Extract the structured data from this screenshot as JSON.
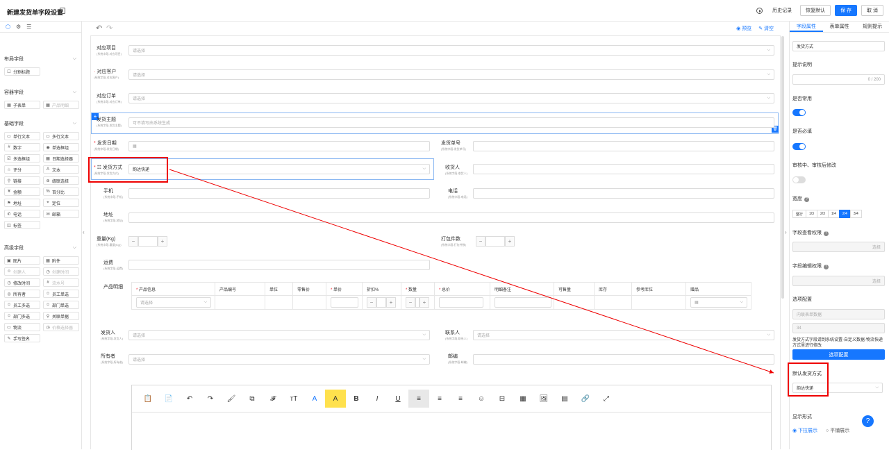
{
  "header": {
    "title": "新建发货单字段设置",
    "history": "历史记录",
    "restore": "恢复默认",
    "save": "保 存",
    "cancel": "取 消"
  },
  "left": {
    "groups": [
      {
        "title": "布局字段",
        "items": [
          {
            "label": "分割标题",
            "icon": "☐",
            "disabled": false
          }
        ]
      },
      {
        "title": "容器字段",
        "items": [
          {
            "label": "子表单",
            "icon": "▦",
            "disabled": false
          },
          {
            "label": "产品明细",
            "icon": "▦",
            "disabled": true
          }
        ]
      },
      {
        "title": "基础字段",
        "items": [
          {
            "label": "单行文本",
            "icon": "▭",
            "disabled": false
          },
          {
            "label": "多行文本",
            "icon": "▭",
            "disabled": false
          },
          {
            "label": "数字",
            "icon": "#",
            "disabled": false
          },
          {
            "label": "单选框组",
            "icon": "◉",
            "disabled": false
          },
          {
            "label": "多选框组",
            "icon": "☑",
            "disabled": false
          },
          {
            "label": "日期选择器",
            "icon": "▦",
            "disabled": false
          },
          {
            "label": "评分",
            "icon": "☆",
            "disabled": false
          },
          {
            "label": "文本",
            "icon": "A",
            "disabled": false
          },
          {
            "label": "链接",
            "icon": "⚲",
            "disabled": false
          },
          {
            "label": "级联选择",
            "icon": "⊕",
            "disabled": false
          },
          {
            "label": "金额",
            "icon": "¥",
            "disabled": false
          },
          {
            "label": "百分比",
            "icon": "%",
            "disabled": false
          },
          {
            "label": "地址",
            "icon": "⚑",
            "disabled": false
          },
          {
            "label": "定位",
            "icon": "⌖",
            "disabled": false
          },
          {
            "label": "电话",
            "icon": "✆",
            "disabled": false
          },
          {
            "label": "邮箱",
            "icon": "✉",
            "disabled": false
          },
          {
            "label": "标签",
            "icon": "◫",
            "disabled": false
          }
        ]
      },
      {
        "title": "高级字段",
        "items": [
          {
            "label": "图片",
            "icon": "▣",
            "disabled": false
          },
          {
            "label": "附件",
            "icon": "▦",
            "disabled": false
          },
          {
            "label": "创建人",
            "icon": "☺",
            "disabled": true
          },
          {
            "label": "创建时间",
            "icon": "◷",
            "disabled": true
          },
          {
            "label": "修改时间",
            "icon": "◷",
            "disabled": false
          },
          {
            "label": "流水号",
            "icon": "#",
            "disabled": true
          },
          {
            "label": "所有者",
            "icon": "◎",
            "disabled": false
          },
          {
            "label": "员工单选",
            "icon": "☺",
            "disabled": false
          },
          {
            "label": "员工多选",
            "icon": "☺",
            "disabled": false
          },
          {
            "label": "部门单选",
            "icon": "☺",
            "disabled": false
          },
          {
            "label": "部门多选",
            "icon": "☺",
            "disabled": false
          },
          {
            "label": "关联单据",
            "icon": "⚲",
            "disabled": false
          },
          {
            "label": "物流",
            "icon": "▭",
            "disabled": false
          },
          {
            "label": "价格选择器",
            "icon": "◷",
            "disabled": true
          },
          {
            "label": "手写签名",
            "icon": "✎",
            "disabled": false
          }
        ]
      }
    ]
  },
  "canvas": {
    "preview": "预览",
    "clear": "清空",
    "placeholder": "请选择",
    "f1": {
      "label": "对应项目",
      "sub": "(系统字段-对应项目)"
    },
    "f2": {
      "label": "对应客户",
      "sub": "(系统字段-对应客户)"
    },
    "f3": {
      "label": "对应订单",
      "sub": "(系统字段-对应订单)"
    },
    "f4": {
      "label": "发货主题",
      "sub": "(系统字段-发货主题)",
      "placeholder": "可不填写由系统生成"
    },
    "f5": {
      "label": "发货日期",
      "sub": "(系统字段-发货日期)"
    },
    "f6": {
      "label": "发货单号",
      "sub": "(系统字段-发货单号)"
    },
    "f7": {
      "label": "发货方式",
      "sub": "(系统字段-发货方式)",
      "value": "韵达快递"
    },
    "f8": {
      "label": "收货人",
      "sub": "(系统字段-收货人)"
    },
    "f9": {
      "label": "手机",
      "sub": "(系统字段-手机)"
    },
    "f10": {
      "label": "电话",
      "sub": "(系统字段-电话)"
    },
    "f11": {
      "label": "地址",
      "sub": "(系统字段-地址)"
    },
    "f12": {
      "label": "重量(Kg)",
      "sub": "(系统字段-重量(Kg))"
    },
    "f13": {
      "label": "打包件数",
      "sub": "(系统字段-打包件数)"
    },
    "f14": {
      "label": "运费",
      "sub": "(系统字段-运费)"
    },
    "products": {
      "label": "产品明细",
      "cols": [
        "产品信息",
        "产品编号",
        "单位",
        "零售价",
        "单价",
        "折扣%",
        "数量",
        "总价",
        "明细备注",
        "可售量",
        "库存",
        "参考库位",
        "赠品"
      ]
    },
    "f15": {
      "label": "发货人",
      "sub": "(系统字段-发货人)"
    },
    "f16": {
      "label": "联系人",
      "sub": "(系统字段-联系人)"
    },
    "f17": {
      "label": "所有者",
      "sub": "(系统字段-所有者)"
    },
    "f18": {
      "label": "邮编",
      "sub": "(系统字段-邮编)"
    }
  },
  "right": {
    "tabs": [
      "字段属性",
      "表单属性",
      "规则提示"
    ],
    "title_value": "发货方式",
    "hint_label": "提示说明",
    "hint_count": "0 / 200",
    "common_label": "是否常用",
    "required_label": "是否必填",
    "review_label": "审核中、审核后修改",
    "width_label": "宽度",
    "widths": [
      "整行",
      "1/3",
      "2/3",
      "1/4",
      "2/4",
      "3/4"
    ],
    "view_perm": "字段查看权限",
    "edit_perm": "字段编辑权限",
    "select_ph": "选择",
    "option_label": "选项配置",
    "option_src": "内联表单数据",
    "option_num": "34",
    "option_note": "发货方式字段请到系统设置-自定义数据-物流快递方式里进行修改",
    "option_btn": "选项配置",
    "default_label": "默认发货方式",
    "default_value": "韵达快递",
    "display_label": "显示形式",
    "display_opt1": "下拉展示",
    "display_opt2": "平铺展示"
  },
  "colors": {
    "accent": "#1677ff",
    "highlight": "#e00000"
  }
}
